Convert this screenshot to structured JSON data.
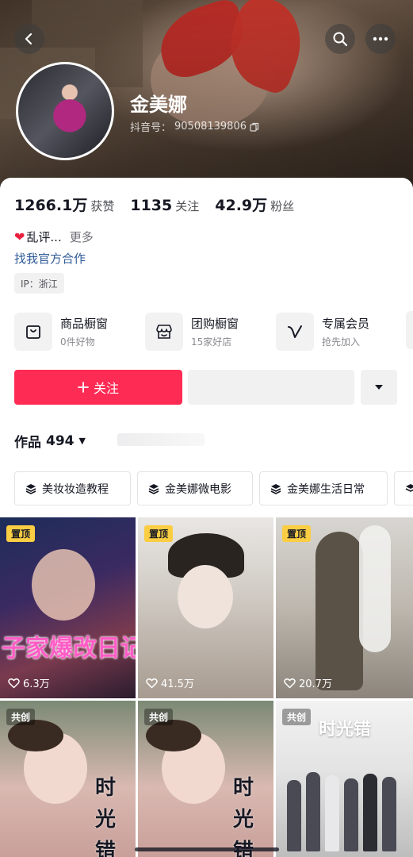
{
  "header": {
    "name": "金美娜",
    "douyin_id_label": "抖音号：",
    "douyin_id": "90508139806"
  },
  "stats": [
    {
      "value": "1266.1万",
      "label": "获赞"
    },
    {
      "value": "1135",
      "label": "关注"
    },
    {
      "value": "42.9万",
      "label": "粉丝"
    }
  ],
  "bio": {
    "text": "乱评...",
    "more": "更多",
    "collab_link": "找我官方合作",
    "ip": "IP：浙江"
  },
  "shop": [
    {
      "title": "商品橱窗",
      "sub": "0件好物",
      "icon": "bag-icon"
    },
    {
      "title": "团购橱窗",
      "sub": "15家好店",
      "icon": "store-icon"
    },
    {
      "title": "专属会员",
      "sub": "抢先加入",
      "icon": "v-member-icon"
    }
  ],
  "actions": {
    "follow": "关注"
  },
  "works": {
    "title": "作品",
    "count": "494"
  },
  "collections": [
    {
      "label": "美妆妆造教程"
    },
    {
      "label": "金美娜微电影"
    },
    {
      "label": "金美娜生活日常"
    }
  ],
  "videos": [
    {
      "badge": "置顶",
      "likes": "6.3万",
      "overlay": "子家爆改日记"
    },
    {
      "badge": "置顶",
      "likes": "41.5万",
      "overlay": ""
    },
    {
      "badge": "置顶",
      "likes": "20.7万",
      "overlay": ""
    },
    {
      "badge": "共创",
      "likes": "",
      "overlay": "时光错"
    },
    {
      "badge": "共创",
      "likes": "",
      "overlay": "时光错"
    },
    {
      "badge": "共创",
      "likes": "",
      "overlay": "时光错"
    }
  ],
  "colors": {
    "accent": "#fe2c55",
    "pin_badge": "#facd43",
    "link": "#2f5a97"
  }
}
